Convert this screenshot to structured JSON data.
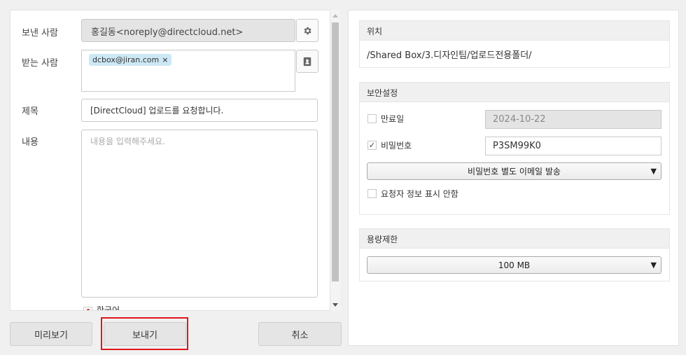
{
  "form": {
    "sender_label": "보낸 사람",
    "sender_value": "홍길동<noreply@directcloud.net>",
    "recipient_label": "받는 사람",
    "recipient_tag": "dcbox@jiran.com",
    "recipient_tag_remove": "×",
    "subject_label": "제목",
    "subject_value": "[DirectCloud] 업로드를 요청합니다.",
    "content_label": "내용",
    "content_placeholder": "내용을 입력해주세요.",
    "language": "한국어"
  },
  "buttons": {
    "preview": "미리보기",
    "send": "보내기",
    "cancel": "취소"
  },
  "location": {
    "title": "위치",
    "path": "/Shared Box/3.디자인팀/업로드전용폴더/"
  },
  "security": {
    "title": "보안설정",
    "expiry_label": "만료일",
    "expiry_checked": false,
    "expiry_value": "2024-10-22",
    "password_label": "비밀번호",
    "password_checked": true,
    "password_checkmark": "✓",
    "password_value": "P3SM99K0",
    "password_delivery_option": "비밀번호 별도 이메일 발송",
    "hide_requester_label": "요청자 정보 표시 안함",
    "hide_requester_checked": false
  },
  "capacity": {
    "title": "용량제한",
    "limit_option": "100 MB"
  },
  "colors": {
    "highlight_border": "#e0161b",
    "tag_background": "#cde8f5"
  }
}
